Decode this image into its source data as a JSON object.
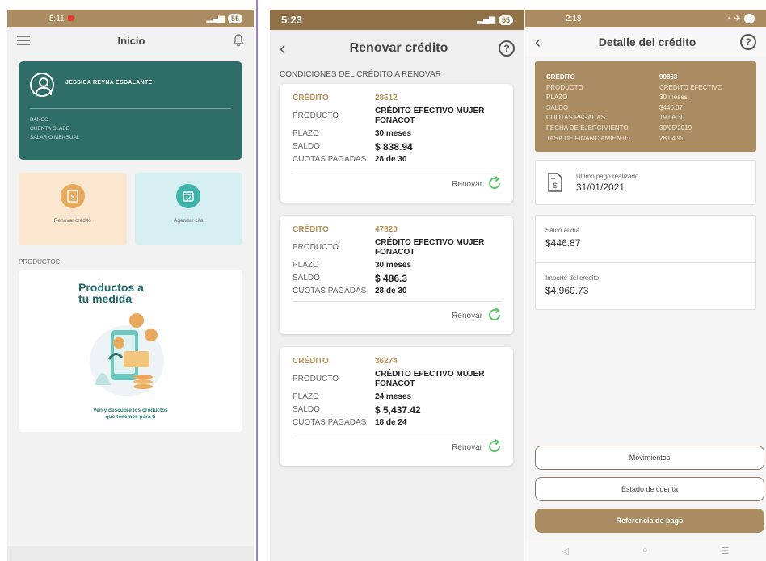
{
  "home": {
    "status_time": "5:11",
    "status_battery": "55",
    "title": "Inicio",
    "user_name": "JESSICA  REYNA ESCALANTE",
    "fields": [
      "BANCO",
      "CUENTA CLABE",
      "SALARIO MENSUAL"
    ],
    "tiles": [
      {
        "label": "Renovar crédito"
      },
      {
        "label": "Agendar cita"
      }
    ],
    "section_label": "PRODUCTOS",
    "promo_title_1": "Productos a",
    "promo_title_2": "tu medida",
    "promo_sub_1": "Ven y descubre los productos",
    "promo_sub_2": "que tenemos para ti"
  },
  "renew": {
    "status_time": "5:23",
    "status_battery": "55",
    "title": "Renovar crédito",
    "help": "?",
    "conditions_label": "CONDICIONES DEL CRÉDITO A RENOVAR",
    "labels": {
      "credit": "CRÉDITO",
      "product": "PRODUCTO",
      "term": "PLAZO",
      "balance": "SALDO",
      "paid": "CUOTAS PAGADAS"
    },
    "renew_label": "Renovar",
    "credits": [
      {
        "id": "28512",
        "product": "CRÉDITO EFECTIVO MUJER FONACOT",
        "term": "30 meses",
        "balance": "$ 838.94",
        "paid": "28 de 30"
      },
      {
        "id": "47820",
        "product": "CRÉDITO EFECTIVO MUJER FONACOT",
        "term": "30 meses",
        "balance": "$ 486.3",
        "paid": "28 de 30"
      },
      {
        "id": "36274",
        "product": "CRÉDITO EFECTIVO MUJER FONACOT",
        "term": "24 meses",
        "balance": "$ 5,437.42",
        "paid": "18 de 24"
      }
    ]
  },
  "detail": {
    "status_time": "2:18",
    "title": "Detalle del crédito",
    "help": "?",
    "rows": [
      {
        "k": "CREDITO",
        "v": "99863"
      },
      {
        "k": "PRODUCTO",
        "v": "CRÉDITO EFECTIVO"
      },
      {
        "k": "PLAZO",
        "v": "30 meses"
      },
      {
        "k": "SALDO",
        "v": "$446.87"
      },
      {
        "k": "CUOTAS PAGADAS",
        "v": "19 de 30"
      },
      {
        "k": "FECHA DE EJERCIMIENTO",
        "v": "30/05/2019"
      },
      {
        "k": "TASA DE FINANCIAMIENTO",
        "v": "28.04 %"
      }
    ],
    "last_payment_label": "Último pago realizado",
    "last_payment_date": "31/01/2021",
    "balance_label": "Saldo al día",
    "balance_value": "$446.87",
    "amount_label": "Importe del crédito",
    "amount_value": "$4,960.73",
    "btn_movements": "Movimientos",
    "btn_statement": "Estado de cuenta",
    "btn_reference": "Referencia de pago",
    "nav": [
      "◁",
      "○",
      "☰"
    ]
  }
}
